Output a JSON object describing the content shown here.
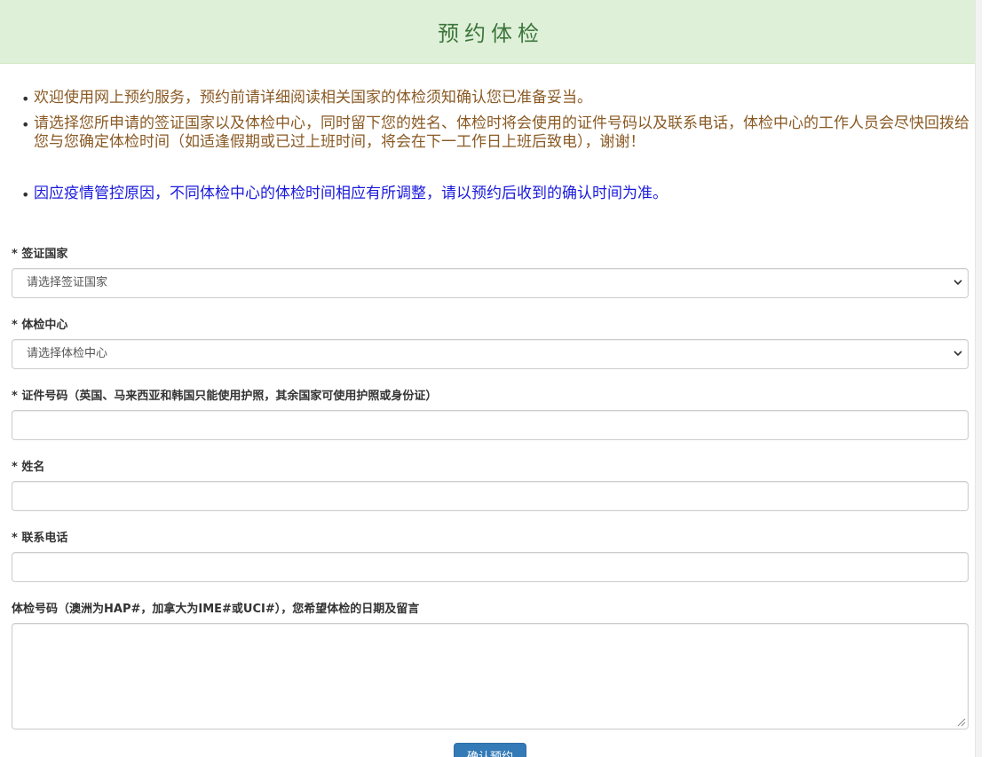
{
  "header": {
    "title": "预约体检"
  },
  "notices": [
    "欢迎使用网上预约服务，预约前请详细阅读相关国家的体检须知确认您已准备妥当。",
    "请选择您所申请的签证国家以及体检中心，同时留下您的姓名、体检时将会使用的证件号码以及联系电话，体检中心的工作人员会尽快回拨给您与您确定体检时间（如适逢假期或已过上班时间，将会在下一工作日上班后致电），谢谢！",
    "因应疫情管控原因，不同体检中心的体检时间相应有所调整，请以预约后收到的确认时间为准。"
  ],
  "form": {
    "country": {
      "label": "* 签证国家",
      "selected": "请选择签证国家"
    },
    "center": {
      "label": "* 体检中心",
      "selected": "请选择体检中心"
    },
    "id_number": {
      "label": "* 证件号码（英国、马来西亚和韩国只能使用护照，其余国家可使用护照或身份证）",
      "value": ""
    },
    "name": {
      "label": "* 姓名",
      "value": ""
    },
    "phone": {
      "label": "* 联系电话",
      "value": ""
    },
    "message": {
      "label": "体检号码（澳洲为HAP#，加拿大为IME#或UCI#），您希望体检的日期及留言",
      "value": ""
    },
    "submit_label": "确认预约"
  },
  "colors": {
    "header_bg": "#dff0d8",
    "header_text": "#3c763d",
    "notice_brown": "#8a5a24",
    "notice_blue": "#1a1adc",
    "button_bg": "#337ab7"
  },
  "icons": {
    "select_arrow": "chevron-down-icon",
    "resize": "resize-grip-icon"
  }
}
